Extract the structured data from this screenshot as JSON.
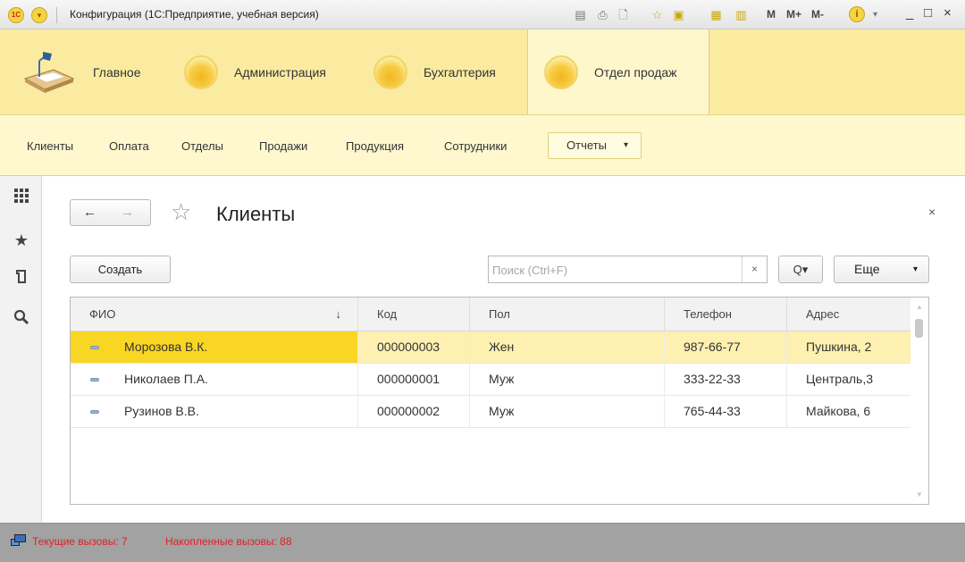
{
  "window": {
    "title": "Конфигурация  (1С:Предприятие, учебная версия)",
    "logo_text": "1С",
    "toolbar": [
      "save-icon",
      "print-icon",
      "preview-icon",
      "favorite-add-icon",
      "favorites-icon",
      "calculator-icon",
      "calendar-icon"
    ],
    "memory_buttons": [
      "M",
      "M+",
      "M-"
    ],
    "controls": {
      "minimize": "_",
      "maximize": "□",
      "close": "×"
    },
    "info_icon": "i",
    "info_caret": "▾"
  },
  "sections": [
    {
      "label": "Главное",
      "icon": "desk-lamp-icon",
      "active": false
    },
    {
      "label": "Администрация",
      "icon": "orb-icon",
      "active": false
    },
    {
      "label": "Бухгалтерия",
      "icon": "orb-icon",
      "active": false
    },
    {
      "label": "Отдел продаж",
      "icon": "orb-icon",
      "active": true
    }
  ],
  "commands": {
    "items": [
      "Клиенты",
      "Оплата",
      "Отделы",
      "Продажи",
      "Продукция",
      "Сотрудники"
    ],
    "reports_label": "Отчеты",
    "reports_caret": "▾"
  },
  "left_tools": [
    "apps-grid-icon",
    "star-icon",
    "history-icon",
    "search-icon"
  ],
  "form": {
    "back": "←",
    "forward": "→",
    "title": "Клиенты",
    "close": "×",
    "create_label": "Создать",
    "search_placeholder": "Поиск (Ctrl+F)",
    "search_clear": "×",
    "search_mode": "Q▾",
    "more_label": "Еще",
    "more_caret": "▾"
  },
  "table": {
    "columns": [
      "ФИО",
      "Код",
      "Пол",
      "Телефон",
      "Адрес"
    ],
    "sort_indicator": "↓",
    "rows": [
      {
        "fio": "Морозова В.К.",
        "code": "000000003",
        "sex": "Жен",
        "phone": "987-66-77",
        "address": "Пушкина, 2",
        "selected": true
      },
      {
        "fio": "Николаев П.А.",
        "code": "000000001",
        "sex": "Муж",
        "phone": "333-22-33",
        "address": "Централь,3",
        "selected": false
      },
      {
        "fio": "Рузинов В.В.",
        "code": "000000002",
        "sex": "Муж",
        "phone": "765-44-33",
        "address": "Майкова, 6",
        "selected": false
      }
    ]
  },
  "status": {
    "current_calls": "Текущие вызовы: 7",
    "accumulated_calls": "Накопленные вызовы: 88"
  },
  "colors": {
    "sections_bg": "#fbeba0",
    "commands_bg": "#fff8cf",
    "selected_row": "#fdf0b0",
    "selected_cell": "#f9d524",
    "status_text": "#e0202a"
  }
}
